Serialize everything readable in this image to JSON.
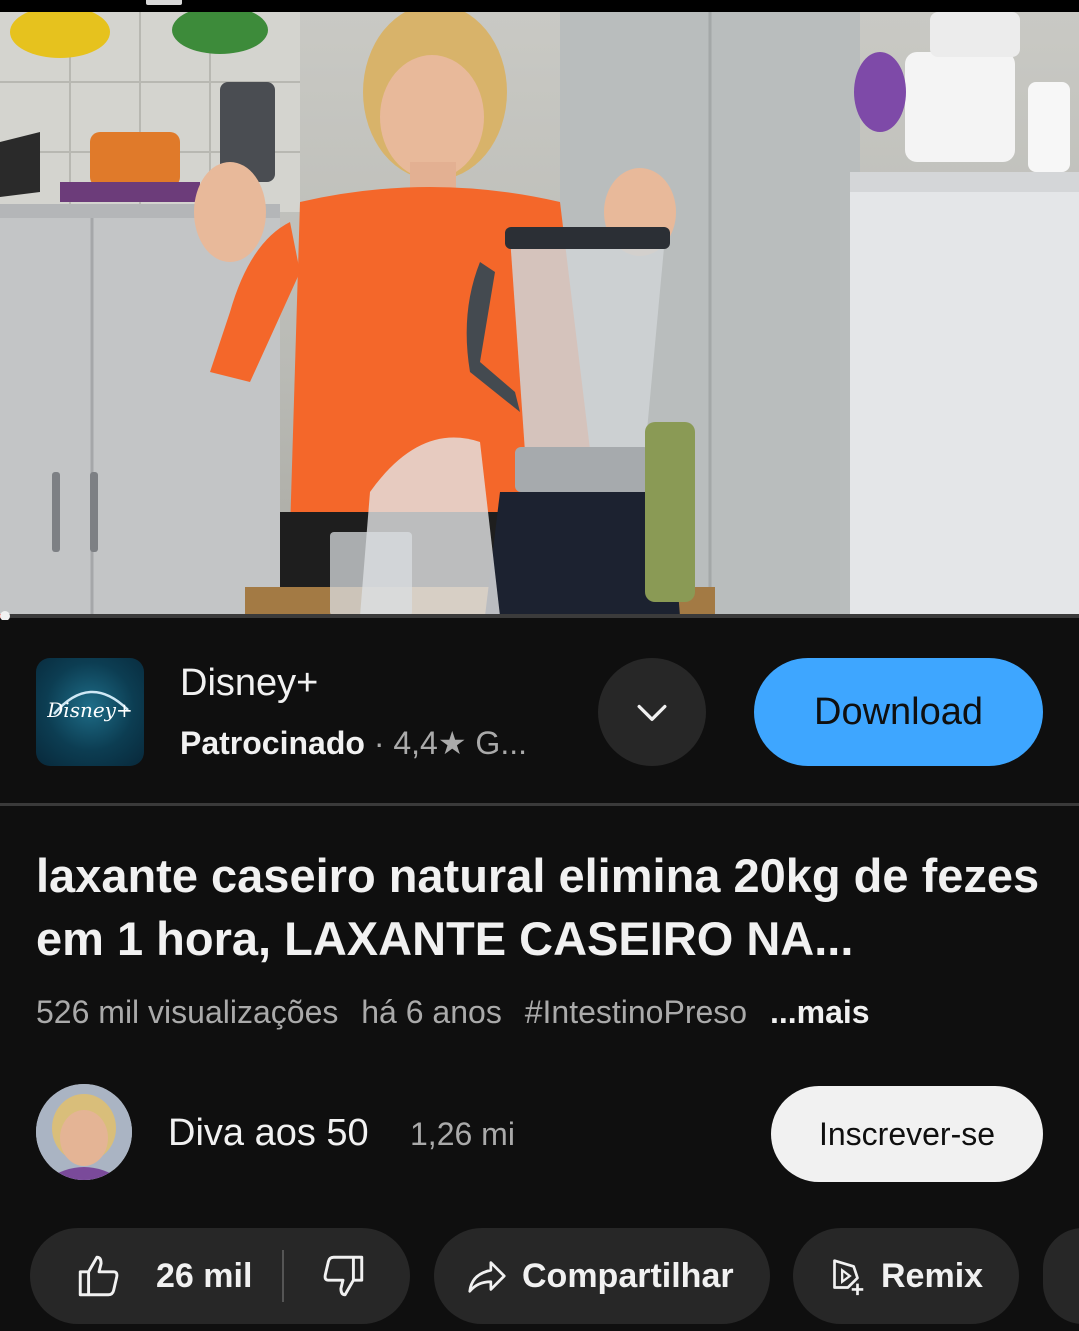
{
  "ad": {
    "advertiser": "Disney+",
    "logo_text": "Disney+",
    "sponsored_label": "Patrocinado",
    "separator": "·",
    "rating": "4,4★ G...",
    "download_label": "Download",
    "colors": {
      "download_bg": "#3ea6ff",
      "logo_bg": "#0c3d52"
    }
  },
  "video": {
    "title": "laxante caseiro natural elimina 20kg de fezes em 1 hora, LAXANTE CASEIRO NA...",
    "views": "526 mil visualizações",
    "age": "há 6 anos",
    "hashtag": "#IntestinoPreso",
    "more_label": "...mais",
    "progress_fraction": 0.002
  },
  "channel": {
    "name": "Diva aos 50",
    "subscribers": "1,26 mi",
    "subscribe_label": "Inscrever-se"
  },
  "actions": {
    "likes": "26 mil",
    "share_label": "Compartilhar",
    "remix_label": "Remix"
  },
  "icons": {
    "expand": "chevron-down-icon",
    "like": "thumbs-up-icon",
    "dislike": "thumbs-down-icon",
    "share": "share-arrow-icon",
    "remix": "remix-icon"
  }
}
